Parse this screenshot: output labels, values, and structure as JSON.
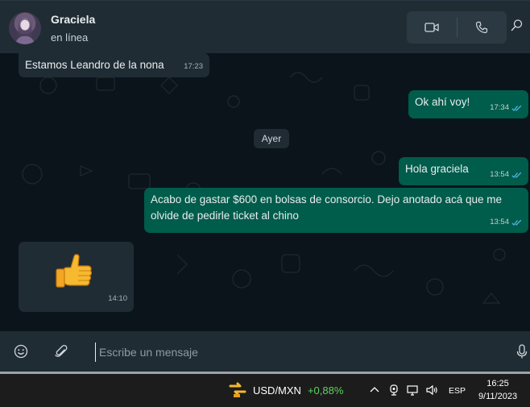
{
  "contact": {
    "name": "Graciela",
    "status": "en línea"
  },
  "header_icons": {
    "video": "video-camera-icon",
    "call": "phone-icon",
    "search": "search-icon"
  },
  "messages": [
    {
      "direction": "in",
      "text": "Estamos Leandro de la nona",
      "time": "17:23"
    },
    {
      "direction": "out",
      "text": "Ok ahí voy!",
      "time": "17:34",
      "read": true
    },
    {
      "direction": "out",
      "text": "Hola graciela",
      "time": "13:54",
      "read": true
    },
    {
      "direction": "out",
      "text": "Acabo de gastar $600 en bolsas de consorcio.  Dejo anotado acá que me olvide de pedirle ticket al chino",
      "time": "13:54",
      "read": true
    },
    {
      "direction": "in",
      "emoji": "👍",
      "time": "14:10"
    }
  ],
  "date_divider": "Ayer",
  "composer": {
    "placeholder": "Escribe un mensaje",
    "value": ""
  },
  "taskbar": {
    "ticker_symbol": "USD/MXN",
    "ticker_change": "+0,88%",
    "ticker_change_color": "#5fd35f",
    "language": "ESP",
    "time": "16:25",
    "date": "9/11/2023"
  },
  "colors": {
    "incoming_bubble": "#202c33",
    "outgoing_bubble": "#005c4b",
    "read_ticks": "#53bdeb",
    "chat_background": "#0b141a"
  }
}
